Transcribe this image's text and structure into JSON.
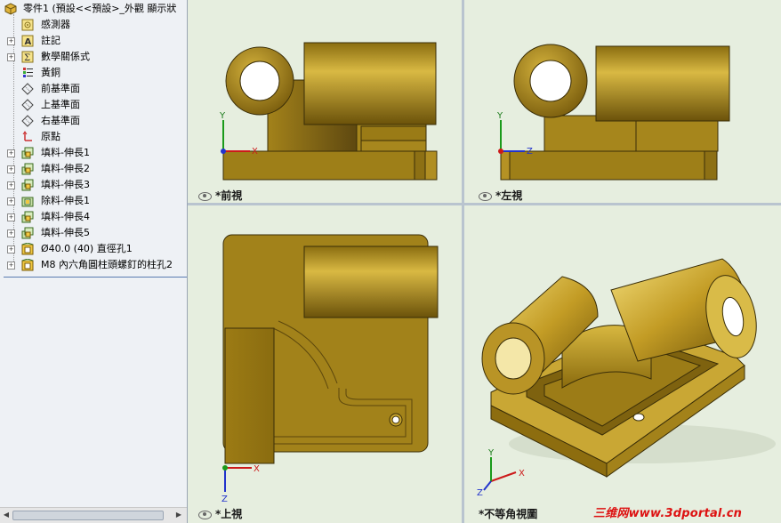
{
  "tree": {
    "root_label": "零件1 (預設<<預設>_外觀 顯示狀",
    "items": [
      {
        "label": "感測器",
        "icon": "sensor-icon"
      },
      {
        "label": "註記",
        "icon": "annotation-icon"
      },
      {
        "label": "數學關係式",
        "icon": "equation-icon"
      },
      {
        "label": "黃銅",
        "icon": "material-icon"
      },
      {
        "label": "前基準面",
        "icon": "plane-icon"
      },
      {
        "label": "上基準面",
        "icon": "plane-icon"
      },
      {
        "label": "右基準面",
        "icon": "plane-icon"
      },
      {
        "label": "原點",
        "icon": "origin-icon"
      },
      {
        "label": "填料-伸長1",
        "icon": "extrude-icon"
      },
      {
        "label": "填料-伸長2",
        "icon": "extrude-icon"
      },
      {
        "label": "填料-伸長3",
        "icon": "extrude-icon"
      },
      {
        "label": "除料-伸長1",
        "icon": "cut-extrude-icon"
      },
      {
        "label": "填料-伸長4",
        "icon": "extrude-icon"
      },
      {
        "label": "填料-伸長5",
        "icon": "extrude-icon"
      },
      {
        "label": "Ø40.0 (40) 直徑孔1",
        "icon": "hole-icon"
      },
      {
        "label": "M8 內六角圓柱頭螺釘的柱孔2",
        "icon": "hole-icon"
      }
    ]
  },
  "viewports": {
    "front": {
      "label": "*前視",
      "axis1": "Y",
      "axis2": "X"
    },
    "left": {
      "label": "*左視",
      "axis1": "Y",
      "axis2": "Z"
    },
    "top": {
      "label": "*上視",
      "axis1": "X",
      "axis2": "Z"
    },
    "iso": {
      "label": "*不等角視圖",
      "axis1": "Y",
      "axis2": "X",
      "axis3": "Z"
    }
  },
  "watermark": "三维网www.3dportal.cn",
  "colors": {
    "viewport_bg": "#e6eedf",
    "brass": "#a8871a",
    "accent_red": "#d11"
  }
}
